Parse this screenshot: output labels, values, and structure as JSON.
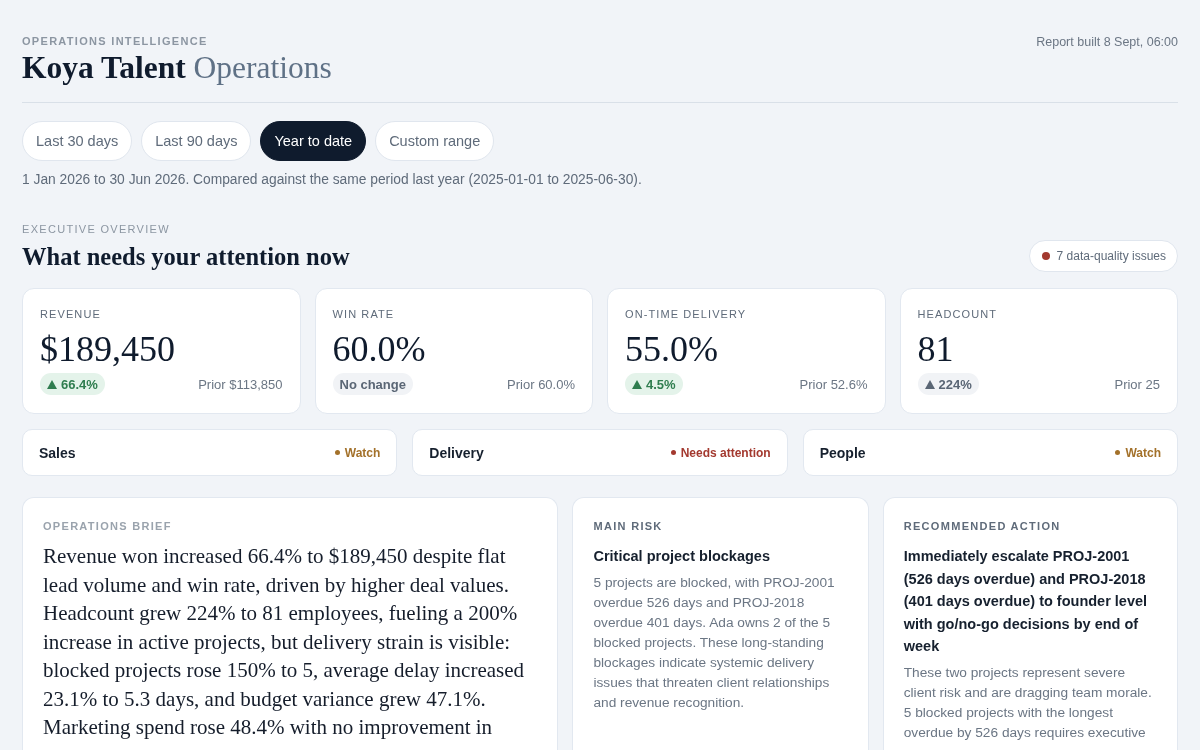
{
  "header": {
    "eyebrow": "OPERATIONS INTELLIGENCE",
    "title": "Koya Talent",
    "title_suffix": "Operations",
    "report_built": "Report built 8 Sept, 06:00"
  },
  "period_tabs": [
    {
      "label": "Last 30 days",
      "selected": false
    },
    {
      "label": "Last 90 days",
      "selected": false
    },
    {
      "label": "Year to date",
      "selected": true
    },
    {
      "label": "Custom range",
      "selected": false
    }
  ],
  "period_note": "1 Jan 2026 to 30 Jun 2026. Compared against the same period last year (2025-01-01 to 2025-06-30).",
  "overview": {
    "eyebrow": "EXECUTIVE OVERVIEW",
    "title": "What needs your attention now",
    "data_quality": {
      "label": "7 data-quality issues"
    }
  },
  "kpis": [
    {
      "label": "REVENUE",
      "value": "$189,450",
      "change": {
        "text": "66.4%",
        "kind": "positive",
        "trend_up": true
      },
      "prior": "Prior $113,850"
    },
    {
      "label": "WIN RATE",
      "value": "60.0%",
      "change": {
        "text": "No change",
        "kind": "neutral",
        "trend_up": false
      },
      "prior": "Prior 60.0%"
    },
    {
      "label": "ON-TIME DELIVERY",
      "value": "55.0%",
      "change": {
        "text": "4.5%",
        "kind": "positive",
        "trend_up": true
      },
      "prior": "Prior 52.6%"
    },
    {
      "label": "HEADCOUNT",
      "value": "81",
      "change": {
        "text": "224%",
        "kind": "neutral",
        "trend_up": true
      },
      "prior": "Prior 25"
    }
  ],
  "areas": [
    {
      "name": "Sales",
      "status": "Watch",
      "color": "#a3712a"
    },
    {
      "name": "Delivery",
      "status": "Needs attention",
      "color": "#a3392f"
    },
    {
      "name": "People",
      "status": "Watch",
      "color": "#a3712a"
    }
  ],
  "brief": {
    "label": "OPERATIONS BRIEF",
    "text": "Revenue won increased 66.4% to $189,450 despite flat lead volume and win rate, driven by higher deal values. Headcount grew 224% to 81 employees, fueling a 200% increase in active projects, but delivery strain is visible: blocked projects rose 150% to 5, average delay increased 23.1% to 5.3 days, and budget variance grew 47.1%. Marketing spend rose 48.4% with no improvement in"
  },
  "main_risk": {
    "label": "MAIN RISK",
    "title": "Critical project blockages",
    "text": "5 projects are blocked, with PROJ-2001 overdue 526 days and PROJ-2018 overdue 401 days. Ada owns 2 of the 5 blocked projects. These long-standing blockages indicate systemic delivery issues that threaten client relationships and revenue recognition."
  },
  "recommended_action": {
    "label": "RECOMMENDED ACTION",
    "title": "Immediately escalate PROJ-2001 (526 days overdue) and PROJ-2018 (401 days overdue) to founder level with go/no-go decisions by end of week",
    "text": "These two projects represent severe client risk and are dragging team morale. 5 blocked projects with the longest overdue by 526 days requires executive"
  }
}
